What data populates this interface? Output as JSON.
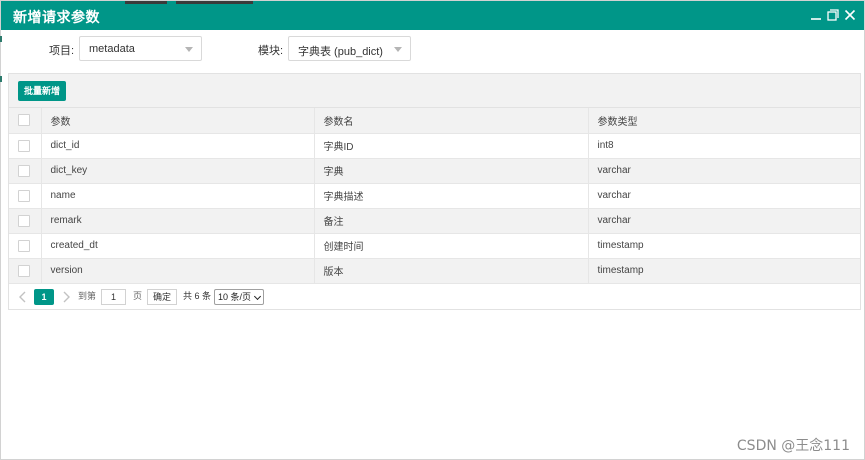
{
  "dialog": {
    "title": "新增请求参数",
    "window_buttons": [
      "minimize-icon",
      "maximize-icon",
      "close-icon"
    ]
  },
  "filters": {
    "project_label": "项目:",
    "project_value": "metadata",
    "module_label": "模块:",
    "module_value": "字典表 (pub_dict)"
  },
  "toolbar": {
    "batch_add_label": "批量新增"
  },
  "table": {
    "columns": [
      "参数",
      "参数名",
      "参数类型"
    ],
    "rows": [
      [
        "dict_id",
        "字典ID",
        "int8"
      ],
      [
        "dict_key",
        "字典",
        "varchar"
      ],
      [
        "name",
        "字典描述",
        "varchar"
      ],
      [
        "remark",
        "备注",
        "varchar"
      ],
      [
        "created_dt",
        "创建时间",
        "timestamp"
      ],
      [
        "version",
        "版本",
        "timestamp"
      ]
    ]
  },
  "pager": {
    "current_page": "1",
    "goto_label": "到第",
    "goto_value": "1",
    "page_unit": "页",
    "confirm_label": "确定",
    "total_label": "共 6 条",
    "page_size": "10 条/页"
  },
  "watermark": "CSDN @王念111",
  "colors": {
    "accent": "#009688",
    "row_alt": "#f2f2f2"
  }
}
